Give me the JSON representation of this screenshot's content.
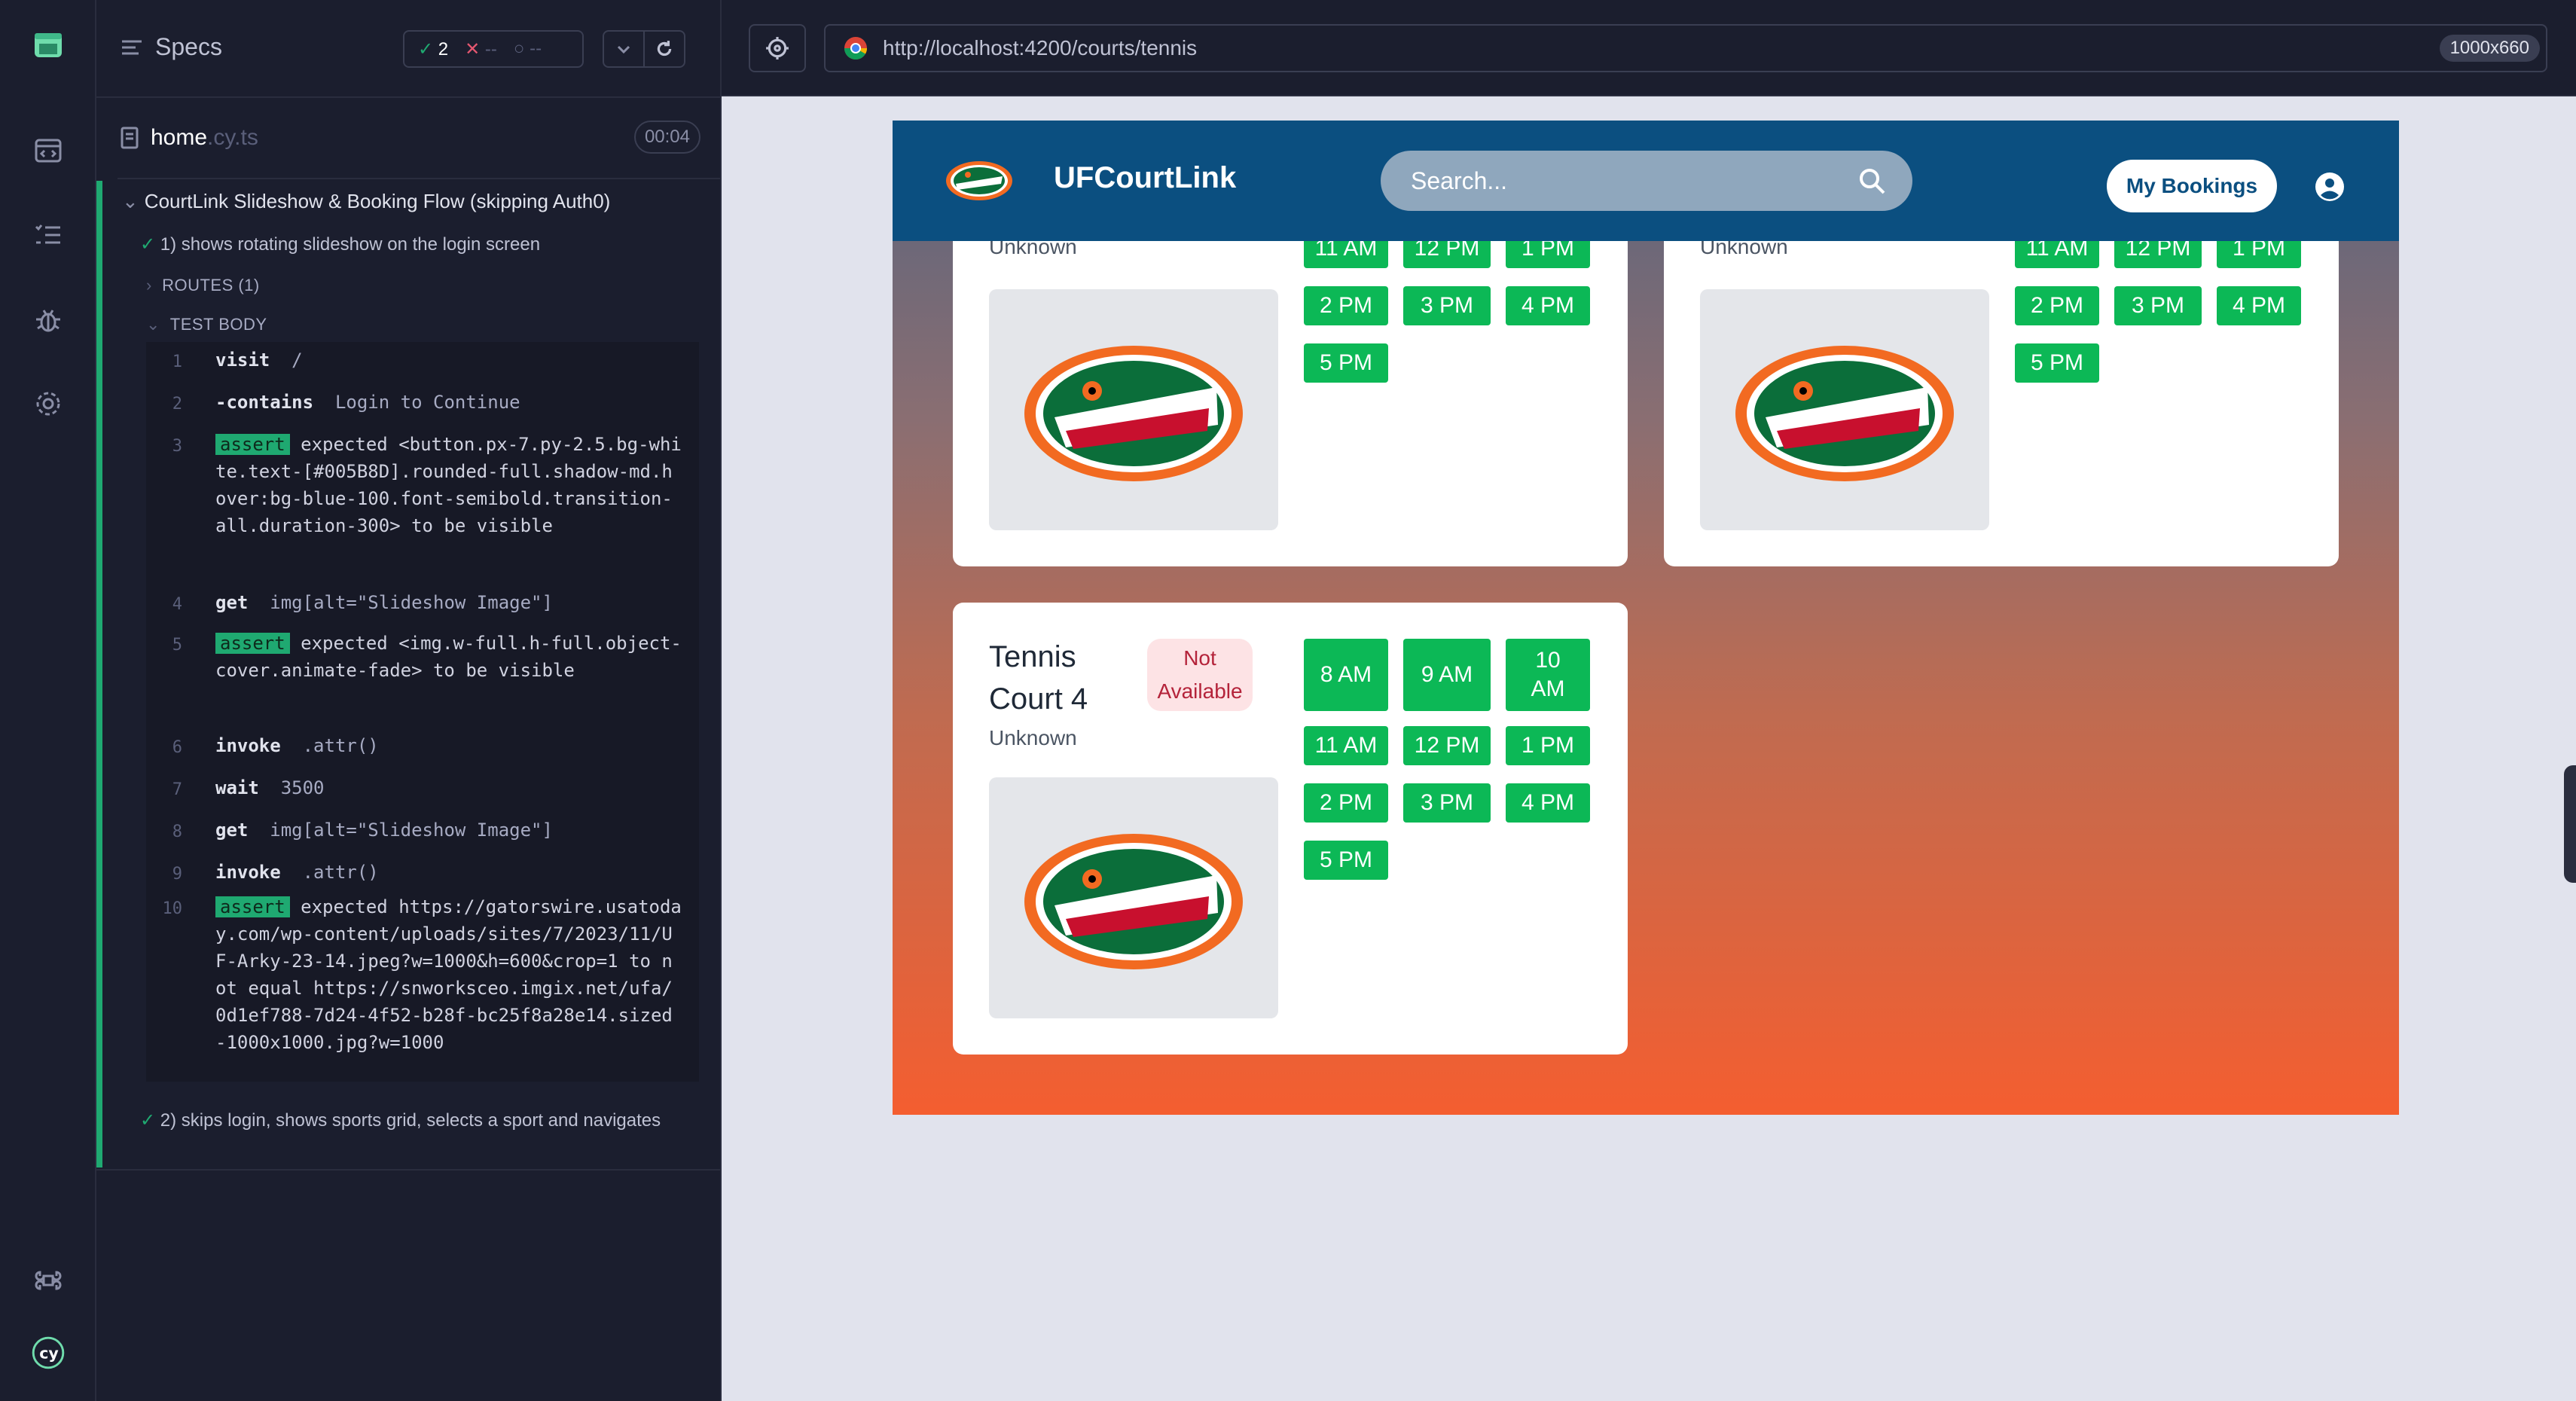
{
  "reporter": {
    "specs_label": "Specs",
    "stats": {
      "passed": "2",
      "failed": "--",
      "pending": "--"
    },
    "spec": {
      "name": "home",
      "ext": ".cy.ts",
      "time": "00:04"
    },
    "suite_title": "CourtLink Slideshow & Booking Flow (skipping Auth0)",
    "test1": "1) shows rotating slideshow on the login screen",
    "routes": "ROUTES (1)",
    "test_body": "TEST BODY",
    "commands": [
      {
        "n": "1",
        "name": "visit",
        "arg": "/"
      },
      {
        "n": "2",
        "name": "-contains",
        "arg": "Login to Continue"
      },
      {
        "n": "3",
        "badge": "assert",
        "text": "expected <button.px-7.py-2.5.bg-white.text-[#005B8D].rounded-full.shadow-md.hover:bg-blue-100.font-semibold.transition-all.duration-300> to be visible"
      },
      {
        "n": "4",
        "name": "get",
        "arg": "img[alt=\"Slideshow Image\"]"
      },
      {
        "n": "5",
        "badge": "assert",
        "text": "expected <img.w-full.h-full.object-cover.animate-fade> to be visible"
      },
      {
        "n": "6",
        "name": "invoke",
        "arg": ".attr()"
      },
      {
        "n": "7",
        "name": "wait",
        "arg": "3500"
      },
      {
        "n": "8",
        "name": "get",
        "arg": "img[alt=\"Slideshow Image\"]"
      },
      {
        "n": "9",
        "name": "invoke",
        "arg": ".attr()"
      },
      {
        "n": "10",
        "badge": "assert",
        "text": "expected https://gatorswire.usatoday.com/wp-content/uploads/sites/7/2023/11/UF-Arky-23-14.jpeg?w=1000&h=600&crop=1 to not equal https://snworksceo.imgix.net/ufa/0d1ef788-7d24-4f52-b28f-bc25f8a28e14.sized-1000x1000.jpg?w=1000"
      }
    ],
    "test2": "2) skips login, shows sports grid, selects a sport and navigates"
  },
  "browser": {
    "url": "http://localhost:4200/courts/tennis",
    "viewport": "1000x660"
  },
  "app": {
    "title": "UFCourtLink",
    "search_placeholder": "Search...",
    "bookings_label": "My Bookings",
    "cards": [
      {
        "name": "",
        "location": "Unknown",
        "status": "",
        "slots": [
          "11 AM",
          "12 PM",
          "1 PM",
          "2 PM",
          "3 PM",
          "4 PM",
          "5 PM"
        ]
      },
      {
        "name": "",
        "location": "Unknown",
        "status": "",
        "slots": [
          "11 AM",
          "12 PM",
          "1 PM",
          "2 PM",
          "3 PM",
          "4 PM",
          "5 PM"
        ]
      },
      {
        "name": "Tennis Court 4",
        "location": "Unknown",
        "status": "Not Available",
        "slots": [
          "8 AM",
          "9 AM",
          "10 AM",
          "11 AM",
          "12 PM",
          "1 PM",
          "2 PM",
          "3 PM",
          "4 PM",
          "5 PM"
        ]
      }
    ]
  },
  "colors": {
    "navbar": "#0b4f80",
    "slot_green": "#0cb856",
    "pass_green": "#1fa971",
    "fail_red": "#e45770"
  }
}
